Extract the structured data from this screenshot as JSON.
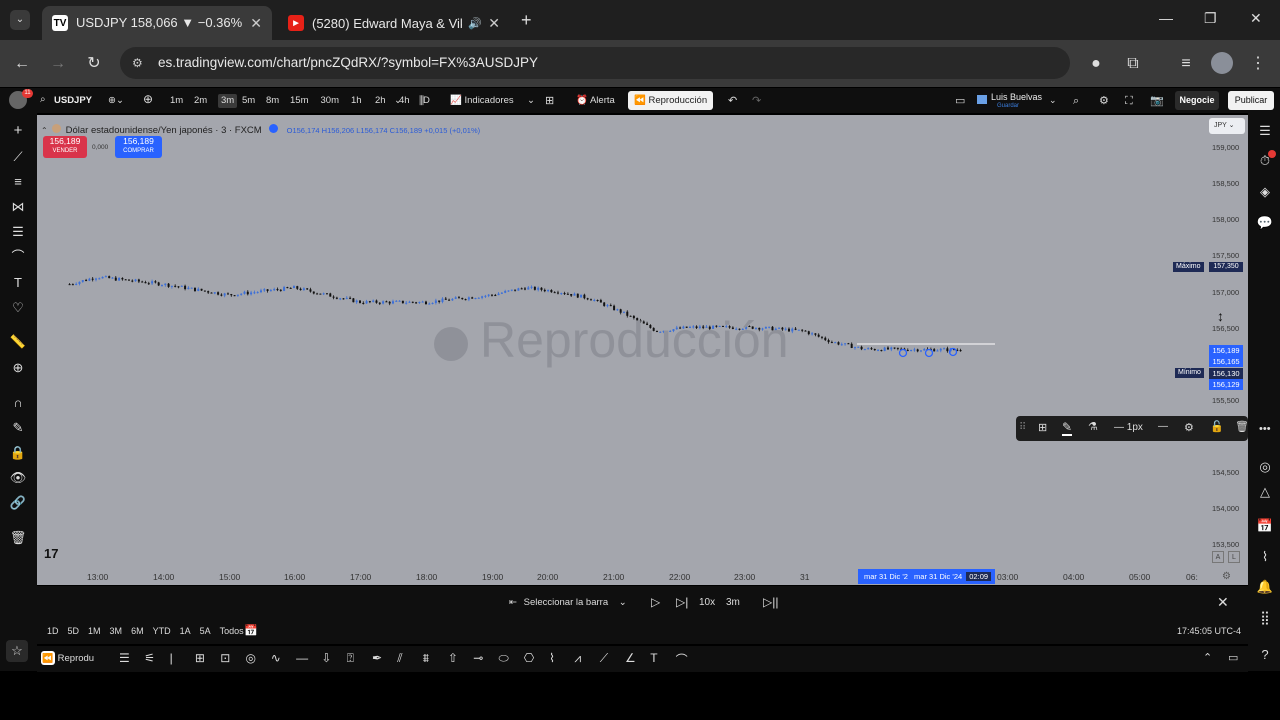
{
  "browser": {
    "tabs": [
      {
        "title": "USDJPY 158,066 ▼ −0.36% 🇺🇸",
        "favicon": "TV"
      },
      {
        "title": "(5280) Edward Maya & Vika",
        "favicon": "▶"
      }
    ],
    "url": "es.tradingview.com/chart/pncZQdRX/?symbol=FX%3AUSDJPY"
  },
  "toolbar": {
    "symbol": "USDJPY",
    "intervals": [
      "1m",
      "2m",
      "3m",
      "5m",
      "8m",
      "15m",
      "30m",
      "1h",
      "2h",
      "4h",
      "D"
    ],
    "active_interval": "3m",
    "indicators_label": "Indicadores",
    "alert_label": "Alerta",
    "replay_label": "Reproducción",
    "user_name": "Luis Buelvas",
    "user_sub": "Guardar",
    "trade_label": "Negocie",
    "publish_label": "Publicar",
    "notif_count": "11"
  },
  "legend": {
    "title": "Dólar estadounidense/Yen japonés · 3 · FXCM",
    "ohlc": "O156,174 H156,206 L156,174 C156,189 +0,015 (+0,01%)",
    "sell_price": "156,189",
    "sell_label": "VENDER",
    "spread": "0,000",
    "buy_price": "156,189",
    "buy_label": "COMPRAR"
  },
  "watermark": "Reproducción",
  "price_axis": {
    "currency": "JPY",
    "ticks": [
      "159,000",
      "158,500",
      "158,000",
      "157,500",
      "157,000",
      "156,500",
      "155,500",
      "154,500",
      "154,000",
      "153,500"
    ],
    "max_label": "Máximo",
    "max_value": "157,350",
    "min_label": "Mínimo",
    "min_value": "156,130",
    "current_values": [
      "156,189",
      "156,165",
      "156,129"
    ],
    "right_badges": [
      "A",
      "L"
    ]
  },
  "time_axis": {
    "ticks": [
      "13:00",
      "14:00",
      "15:00",
      "16:00",
      "17:00",
      "18:00",
      "19:00",
      "20:00",
      "21:00",
      "22:00",
      "23:00",
      "31",
      "03:00",
      "04:00",
      "05:00",
      "06:"
    ],
    "range_label": "mar 31 Dic '2",
    "range_label2": "mar 31 Dic '24",
    "range_time": "02:09"
  },
  "line_tool": {
    "width_label": "1px"
  },
  "replay": {
    "select_bar": "Seleccionar la barra",
    "speed": "10x",
    "interval": "3m"
  },
  "ranges": [
    "1D",
    "5D",
    "1M",
    "3M",
    "6M",
    "YTD",
    "1A",
    "5A",
    "Todos"
  ],
  "clock": "17:45:05 UTC-4",
  "bottom": {
    "tab_label": "Reprodu"
  },
  "chart_data": {
    "type": "candlestick",
    "symbol": "USDJPY",
    "y_range": [
      153.5,
      159.0
    ],
    "approx_close_path": [
      {
        "x": "12:35",
        "y": 157.1
      },
      {
        "x": "13:00",
        "y": 157.2
      },
      {
        "x": "14:00",
        "y": 157.1
      },
      {
        "x": "15:00",
        "y": 156.95
      },
      {
        "x": "16:00",
        "y": 157.05
      },
      {
        "x": "17:00",
        "y": 156.85
      },
      {
        "x": "18:00",
        "y": 156.85
      },
      {
        "x": "19:00",
        "y": 156.95
      },
      {
        "x": "19:30",
        "y": 157.05
      },
      {
        "x": "20:00",
        "y": 157.0
      },
      {
        "x": "20:30",
        "y": 156.9
      },
      {
        "x": "21:00",
        "y": 156.7
      },
      {
        "x": "21:30",
        "y": 156.45
      },
      {
        "x": "22:00",
        "y": 156.5
      },
      {
        "x": "23:00",
        "y": 156.5
      },
      {
        "x": "23:45",
        "y": 156.45
      },
      {
        "x": "00:10",
        "y": 156.3
      },
      {
        "x": "00:40",
        "y": 156.2
      },
      {
        "x": "02:09",
        "y": 156.19
      }
    ]
  }
}
